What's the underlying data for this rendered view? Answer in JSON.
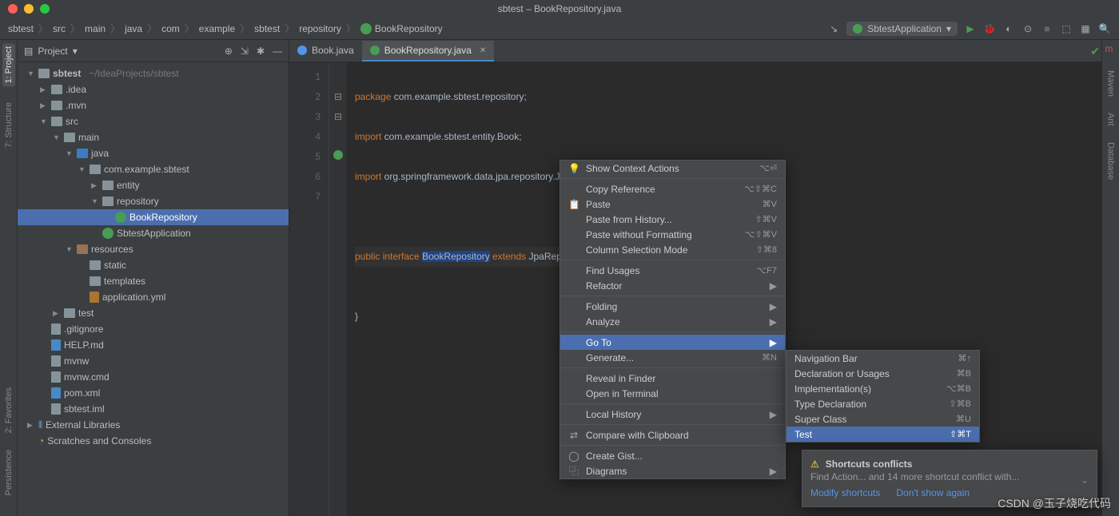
{
  "window": {
    "title": "sbtest – BookRepository.java"
  },
  "breadcrumbs": [
    "sbtest",
    "src",
    "main",
    "java",
    "com",
    "example",
    "sbtest",
    "repository",
    "BookRepository"
  ],
  "runconfig": {
    "label": "SbtestApplication"
  },
  "left_tool": {
    "project": "1: Project",
    "structure": "7: Structure",
    "favorites": "2: Favorites",
    "persistence": "Persistence"
  },
  "right_tool": {
    "maven": "Maven",
    "ant": "Ant",
    "database": "Database"
  },
  "project_panel": {
    "title": "Project"
  },
  "tree": {
    "root": "sbtest",
    "root_hint": "~/IdeaProjects/sbtest",
    "idea": ".idea",
    "mvn": ".mvn",
    "src": "src",
    "main": "main",
    "java": "java",
    "pkg": "com.example.sbtest",
    "entity": "entity",
    "repository": "repository",
    "bookrepo": "BookRepository",
    "app": "SbtestApplication",
    "resources": "resources",
    "static": "static",
    "templates": "templates",
    "yml": "application.yml",
    "test": "test",
    "gitignore": ".gitignore",
    "help": "HELP.md",
    "mvnw": "mvnw",
    "mvnwcmd": "mvnw.cmd",
    "pom": "pom.xml",
    "iml": "sbtest.iml",
    "ext": "External Libraries",
    "scratch": "Scratches and Consoles"
  },
  "tabs": {
    "book": "Book.java",
    "bookrepo": "BookRepository.java"
  },
  "code": {
    "l1": {
      "kw": "package",
      "rest": " com.example.sbtest.repository;"
    },
    "l2": {
      "kw": "import",
      "rest": " com.example.sbtest.entity.Book;"
    },
    "l3": {
      "kw": "import",
      "rest": " org.springframework.data.jpa.repository.JpaRepository;"
    },
    "l5a": "public",
    "l5b": " interface ",
    "l5c": "BookRepository",
    "l5d": " extends ",
    "l5e": "JpaRepository<Book,Integer> {",
    "l5_open": "{",
    "l7": "}"
  },
  "line_numbers": [
    "1",
    "2",
    "3",
    "4",
    "5",
    "6",
    "7"
  ],
  "ctxmenu": {
    "show_actions": "Show Context Actions",
    "show_actions_sc": "⌥⏎",
    "copy_ref": "Copy Reference",
    "copy_ref_sc": "⌥⇧⌘C",
    "paste": "Paste",
    "paste_sc": "⌘V",
    "paste_hist": "Paste from History...",
    "paste_hist_sc": "⇧⌘V",
    "paste_plain": "Paste without Formatting",
    "paste_plain_sc": "⌥⇧⌘V",
    "col_sel": "Column Selection Mode",
    "col_sel_sc": "⇧⌘8",
    "find_usages": "Find Usages",
    "find_usages_sc": "⌥F7",
    "refactor": "Refactor",
    "folding": "Folding",
    "analyze": "Analyze",
    "goto": "Go To",
    "generate": "Generate...",
    "generate_sc": "⌘N",
    "reveal": "Reveal in Finder",
    "terminal": "Open in Terminal",
    "local_hist": "Local History",
    "compare": "Compare with Clipboard",
    "gist": "Create Gist...",
    "diagrams": "Diagrams"
  },
  "submenu": {
    "navbar": "Navigation Bar",
    "navbar_sc": "⌘↑",
    "decl": "Declaration or Usages",
    "decl_sc": "⌘B",
    "impl": "Implementation(s)",
    "impl_sc": "⌥⌘B",
    "typdecl": "Type Declaration",
    "typdecl_sc": "⇧⌘B",
    "super": "Super Class",
    "super_sc": "⌘U",
    "test": "Test",
    "test_sc": "⇧⌘T"
  },
  "notif": {
    "title": "Shortcuts conflicts",
    "body": "Find Action... and 14 more shortcut conflict with...",
    "modify": "Modify shortcuts",
    "dont": "Don't show again"
  },
  "watermark": "CSDN @玉子烧吃代码"
}
